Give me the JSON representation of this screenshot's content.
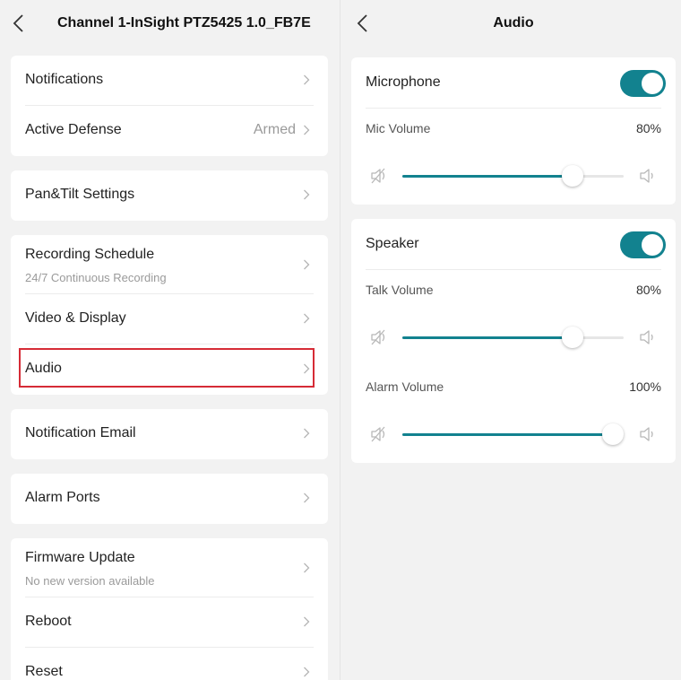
{
  "left": {
    "title": "Channel 1-InSight PTZ5425 1.0_FB7E",
    "groups": [
      {
        "items": [
          {
            "label": "Notifications"
          },
          {
            "label": "Active Defense",
            "value": "Armed"
          }
        ]
      },
      {
        "items": [
          {
            "label": "Pan&Tilt Settings"
          }
        ]
      },
      {
        "items": [
          {
            "label": "Recording Schedule",
            "sub": "24/7 Continuous Recording"
          },
          {
            "label": "Video & Display"
          },
          {
            "label": "Audio"
          }
        ]
      },
      {
        "items": [
          {
            "label": "Notification Email"
          }
        ]
      },
      {
        "items": [
          {
            "label": "Alarm Ports"
          }
        ]
      },
      {
        "items": [
          {
            "label": "Firmware Update",
            "sub": "No new version available"
          },
          {
            "label": "Reboot"
          },
          {
            "label": "Reset"
          }
        ]
      }
    ]
  },
  "right": {
    "title": "Audio",
    "microphone": {
      "label": "Microphone",
      "enabled": true,
      "volume_label": "Mic Volume",
      "volume_value": "80%",
      "volume": 0.77
    },
    "speaker": {
      "label": "Speaker",
      "enabled": true,
      "talk_label": "Talk Volume",
      "talk_value": "80%",
      "talk": 0.77,
      "alarm_label": "Alarm Volume",
      "alarm_value": "100%",
      "alarm": 0.95
    }
  },
  "colors": {
    "accent": "#12828f",
    "highlight": "#d62b36"
  }
}
